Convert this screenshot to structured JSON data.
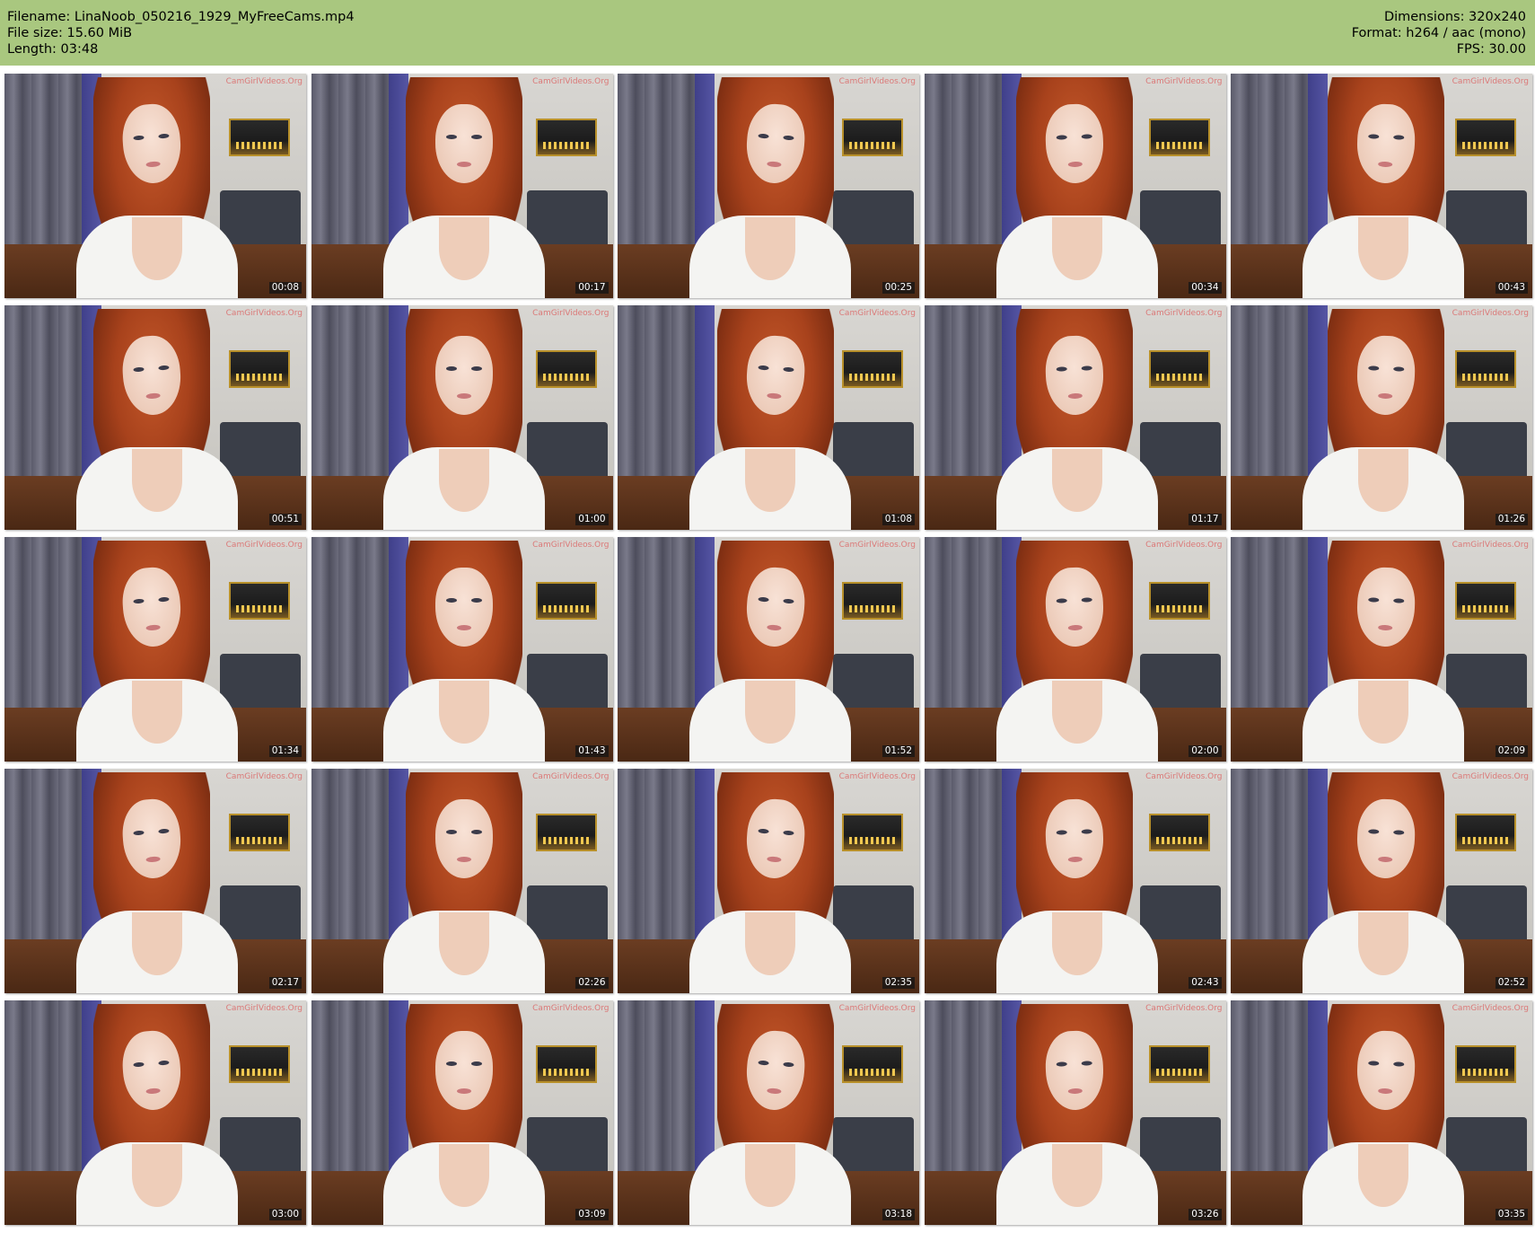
{
  "header": {
    "background": "#a9c77f",
    "filename_line": "Filename: LinaNoob_050216_1929_MyFreeCams.mp4",
    "filesize_line": "File size: 15.60 MiB",
    "length_line": "Length: 03:48",
    "dimensions_line": "Dimensions: 320x240",
    "format_line": "Format: h264 / aac (mono)",
    "fps_line": "FPS: 30.00"
  },
  "watermark_text": "CamGirlVideos.Org",
  "thumbnails": [
    {
      "timestamp": "00:08"
    },
    {
      "timestamp": "00:17"
    },
    {
      "timestamp": "00:25"
    },
    {
      "timestamp": "00:34"
    },
    {
      "timestamp": "00:43"
    },
    {
      "timestamp": "00:51"
    },
    {
      "timestamp": "01:00"
    },
    {
      "timestamp": "01:08"
    },
    {
      "timestamp": "01:17"
    },
    {
      "timestamp": "01:26"
    },
    {
      "timestamp": "01:34"
    },
    {
      "timestamp": "01:43"
    },
    {
      "timestamp": "01:52"
    },
    {
      "timestamp": "02:00"
    },
    {
      "timestamp": "02:09"
    },
    {
      "timestamp": "02:17"
    },
    {
      "timestamp": "02:26"
    },
    {
      "timestamp": "02:35"
    },
    {
      "timestamp": "02:43"
    },
    {
      "timestamp": "02:52"
    },
    {
      "timestamp": "03:00"
    },
    {
      "timestamp": "03:09"
    },
    {
      "timestamp": "03:18"
    },
    {
      "timestamp": "03:26"
    },
    {
      "timestamp": "03:35"
    }
  ]
}
